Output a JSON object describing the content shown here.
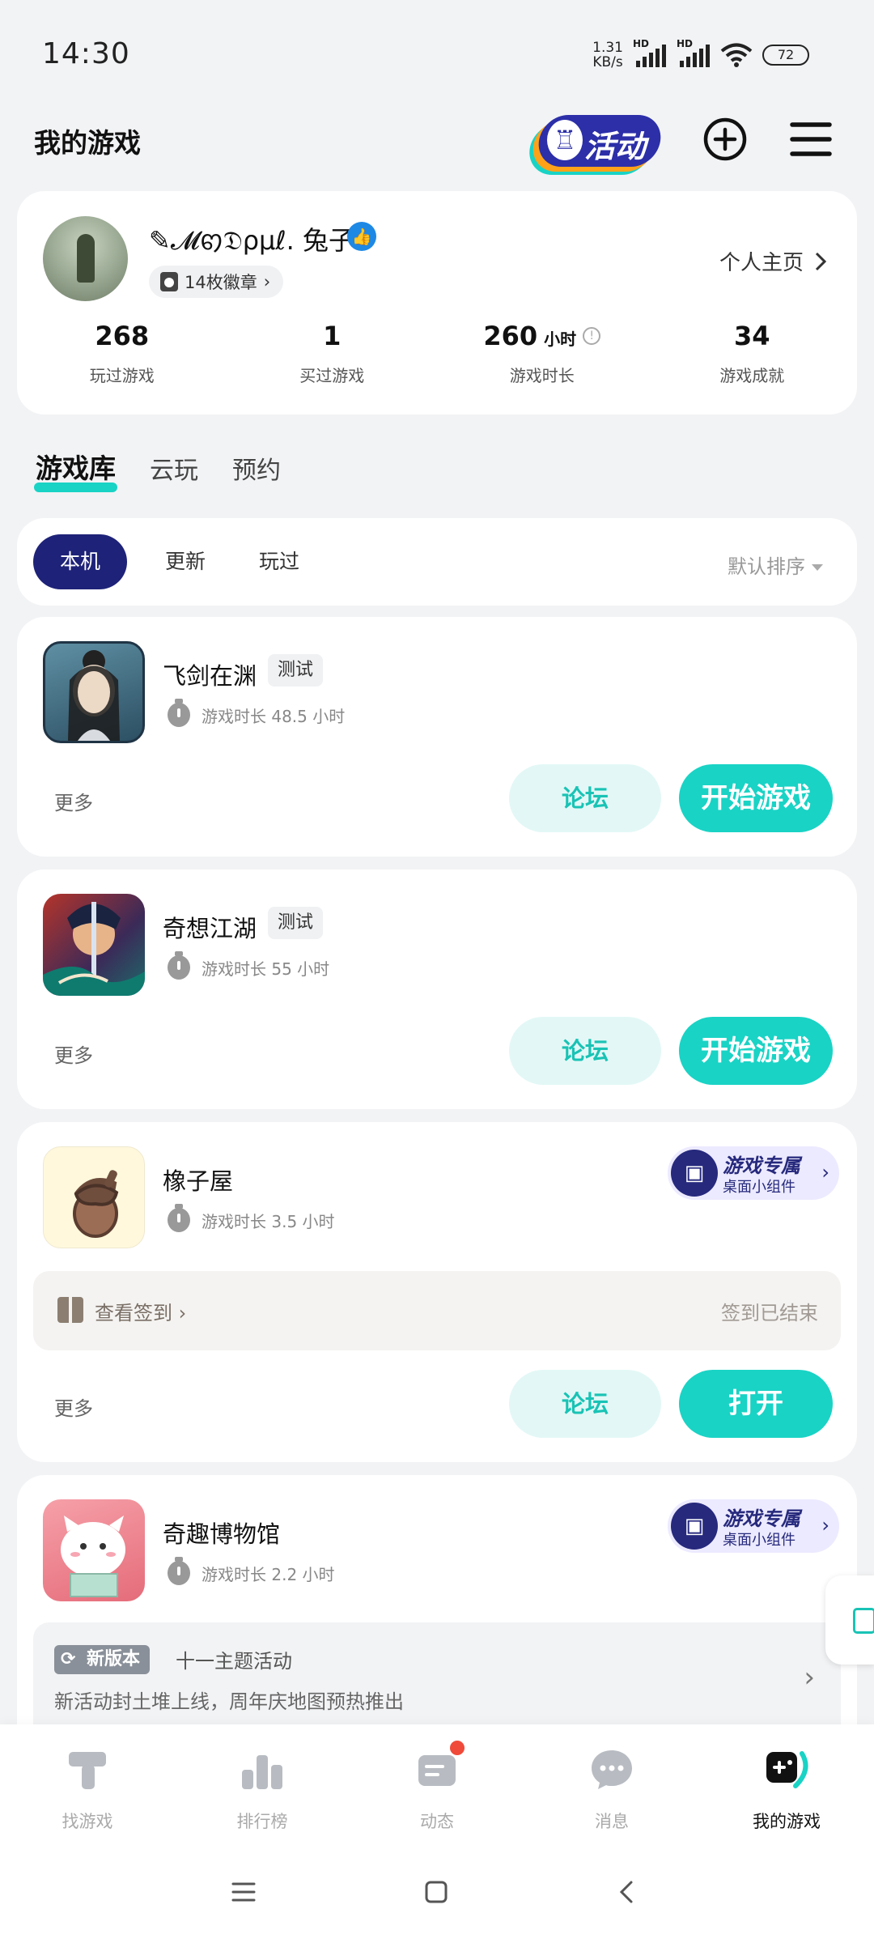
{
  "status_bar": {
    "time": "14:30",
    "net_speed": "1.31",
    "net_speed_unit": "KB/s",
    "signal1_label": "HD",
    "signal2_label": "HD",
    "battery": "72"
  },
  "header": {
    "title": "我的游戏",
    "activity_label": "活动",
    "icons": [
      "activity-badge",
      "add-icon",
      "menu-icon"
    ]
  },
  "profile": {
    "nickname": "✎𝓜ꩅ𝔇ρμℓ.  兔子",
    "badges": "14枚徽章",
    "home_link": "个人主页",
    "stats": [
      {
        "value": "268",
        "unit": "",
        "label": "玩过游戏"
      },
      {
        "value": "1",
        "unit": "",
        "label": "买过游戏"
      },
      {
        "value": "260",
        "unit": "小时",
        "label": "游戏时长"
      },
      {
        "value": "34",
        "unit": "",
        "label": "游戏成就"
      }
    ]
  },
  "tabs": [
    {
      "label": "游戏库",
      "active": true
    },
    {
      "label": "云玩",
      "active": false
    },
    {
      "label": "预约",
      "active": false
    }
  ],
  "filters": {
    "chips": [
      "本机",
      "更新",
      "玩过"
    ],
    "active": "本机",
    "sort": "默认排序"
  },
  "games": [
    {
      "name": "飞剑在渊",
      "tag": "测试",
      "playtime": "游戏时长 48.5 小时",
      "more": "更多",
      "forum": "论坛",
      "action": "开始游戏"
    },
    {
      "name": "奇想江湖",
      "tag": "测试",
      "playtime": "游戏时长 55 小时",
      "more": "更多",
      "forum": "论坛",
      "action": "开始游戏"
    },
    {
      "name": "橡子屋",
      "playtime": "游戏时长 3.5 小时",
      "widget_title": "游戏专属",
      "widget_sub": "桌面小组件",
      "checkin_label": "查看签到",
      "checkin_status": "签到已结束",
      "more": "更多",
      "forum": "论坛",
      "action": "打开"
    },
    {
      "name": "奇趣博物馆",
      "playtime": "游戏时长 2.2 小时",
      "widget_title": "游戏专属",
      "widget_sub": "桌面小组件",
      "news_tag": "新版本",
      "news_title": "十一主题活动",
      "news_desc": "新活动封土堆上线，周年庆地图预热推出"
    }
  ],
  "bottom_nav": [
    {
      "label": "找游戏",
      "active": false
    },
    {
      "label": "排行榜",
      "active": false
    },
    {
      "label": "动态",
      "active": false,
      "dot": true
    },
    {
      "label": "消息",
      "active": false
    },
    {
      "label": "我的游戏",
      "active": true
    }
  ],
  "colors": {
    "accent": "#19d3c5",
    "navy": "#1e2278",
    "background": "#f2f3f5"
  }
}
